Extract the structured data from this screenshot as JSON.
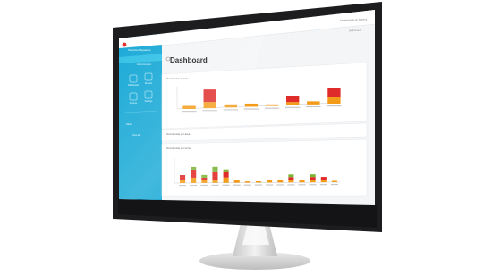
{
  "app": {
    "brand_name": "Shepherd Systems",
    "sidebar_meta": "Administration",
    "sidebar_links": [
      "Dashboard",
      "Reports",
      "Devices",
      "Settings"
    ],
    "sidebar_note": "Alerts",
    "sidebar_note2": "View all",
    "user_menu": "Administração do Sistema",
    "top_tab": "Dashboard"
  },
  "dashboard": {
    "title": "Dashboard",
    "section1": "Ocorrências por dia",
    "section2": "Ocorrências por área",
    "section3": "Ocorrências por turno"
  },
  "colors": {
    "sidebar": "#19a9d6",
    "red": "#e02b2b",
    "orange": "#f39c1a",
    "yellow": "#f4d63a",
    "green": "#7bb536"
  },
  "chart_data": [
    {
      "type": "bar",
      "categories": [
        "",
        "",
        "",
        "",
        "",
        "",
        "",
        ""
      ],
      "series": [
        {
          "values": [
            1,
            2,
            1,
            1,
            0.5,
            1,
            1,
            2
          ],
          "color": "#f39c1a"
        },
        {
          "values": [
            0,
            4,
            0,
            0,
            0,
            2,
            0,
            3
          ],
          "color": "#e02b2b"
        }
      ],
      "ylim": [
        0,
        8
      ]
    },
    {
      "type": "bar",
      "categories": [
        "",
        "",
        "",
        "",
        "",
        "",
        "",
        "",
        "",
        "",
        "",
        "",
        "",
        "",
        ""
      ],
      "series": [
        {
          "values": [
            1,
            2,
            1,
            1,
            2,
            1,
            0.5,
            0.5,
            1,
            1,
            1,
            1,
            1,
            1,
            0.5
          ],
          "color": "#f39c1a"
        },
        {
          "values": [
            2,
            3,
            1,
            3,
            2,
            0,
            0,
            0,
            0,
            0,
            1,
            0,
            1,
            1,
            0
          ],
          "color": "#e02b2b"
        },
        {
          "values": [
            0,
            1,
            1,
            2,
            1,
            0,
            0,
            0,
            0,
            0,
            1,
            0,
            1,
            0,
            0
          ],
          "color": "#7bb536"
        }
      ],
      "ylim": [
        0,
        8
      ]
    }
  ]
}
